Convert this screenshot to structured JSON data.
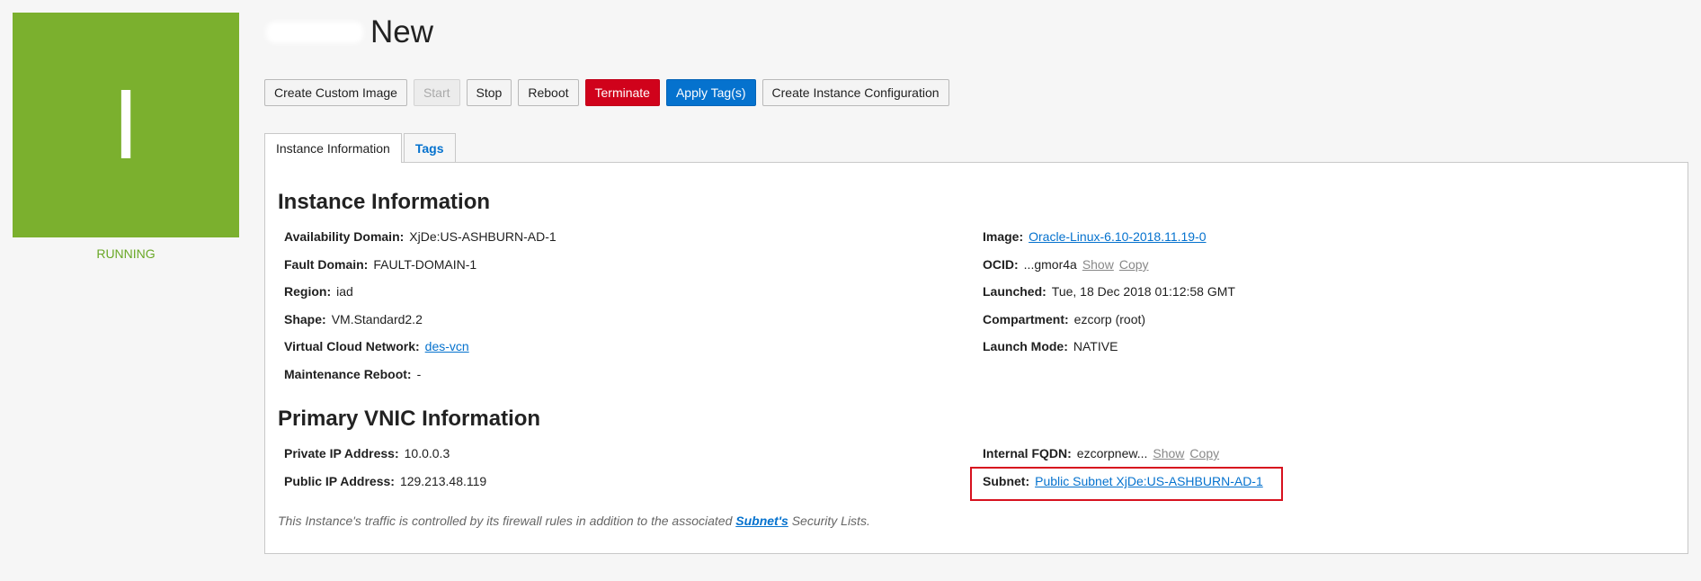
{
  "tile": {
    "letter": "I",
    "status": "RUNNING",
    "color": "#7bb02e"
  },
  "page": {
    "title": "New"
  },
  "actions": {
    "create_custom_image": "Create Custom Image",
    "start": "Start",
    "stop": "Stop",
    "reboot": "Reboot",
    "terminate": "Terminate",
    "apply_tags": "Apply Tag(s)",
    "create_instance_config": "Create Instance Configuration"
  },
  "tabs": {
    "instance_info": "Instance Information",
    "tags": "Tags"
  },
  "instance_info": {
    "heading": "Instance Information",
    "left": [
      {
        "label": "Availability Domain:",
        "value": "XjDe:US-ASHBURN-AD-1"
      },
      {
        "label": "Fault Domain:",
        "value": "FAULT-DOMAIN-1"
      },
      {
        "label": "Region:",
        "value": "iad"
      },
      {
        "label": "Shape:",
        "value": "VM.Standard2.2"
      },
      {
        "label": "Virtual Cloud Network:",
        "link": "des-vcn"
      },
      {
        "label": "Maintenance Reboot:",
        "value": "-"
      }
    ],
    "image": {
      "label": "Image:",
      "link": "Oracle-Linux-6.10-2018.11.19-0"
    },
    "ocid": {
      "label": "OCID:",
      "value": "...gmor4a",
      "show": "Show",
      "copy": "Copy"
    },
    "launched": {
      "label": "Launched:",
      "value": "Tue, 18 Dec 2018 01:12:58 GMT"
    },
    "compartment": {
      "label": "Compartment:",
      "value": "ezcorp (root)"
    },
    "launch_mode": {
      "label": "Launch Mode:",
      "value": "NATIVE"
    }
  },
  "vnic": {
    "heading": "Primary VNIC Information",
    "private_ip": {
      "label": "Private IP Address:",
      "value": "10.0.0.3"
    },
    "public_ip": {
      "label": "Public IP Address:",
      "value": "129.213.48.119"
    },
    "fqdn": {
      "label": "Internal FQDN:",
      "value": "ezcorpnew...",
      "show": "Show",
      "copy": "Copy"
    },
    "subnet": {
      "label": "Subnet:",
      "link": "Public Subnet XjDe:US-ASHBURN-AD-1"
    }
  },
  "note": {
    "before": "This Instance's traffic is controlled by its firewall rules in addition to the associated ",
    "link": "Subnet's",
    "after": " Security Lists."
  }
}
